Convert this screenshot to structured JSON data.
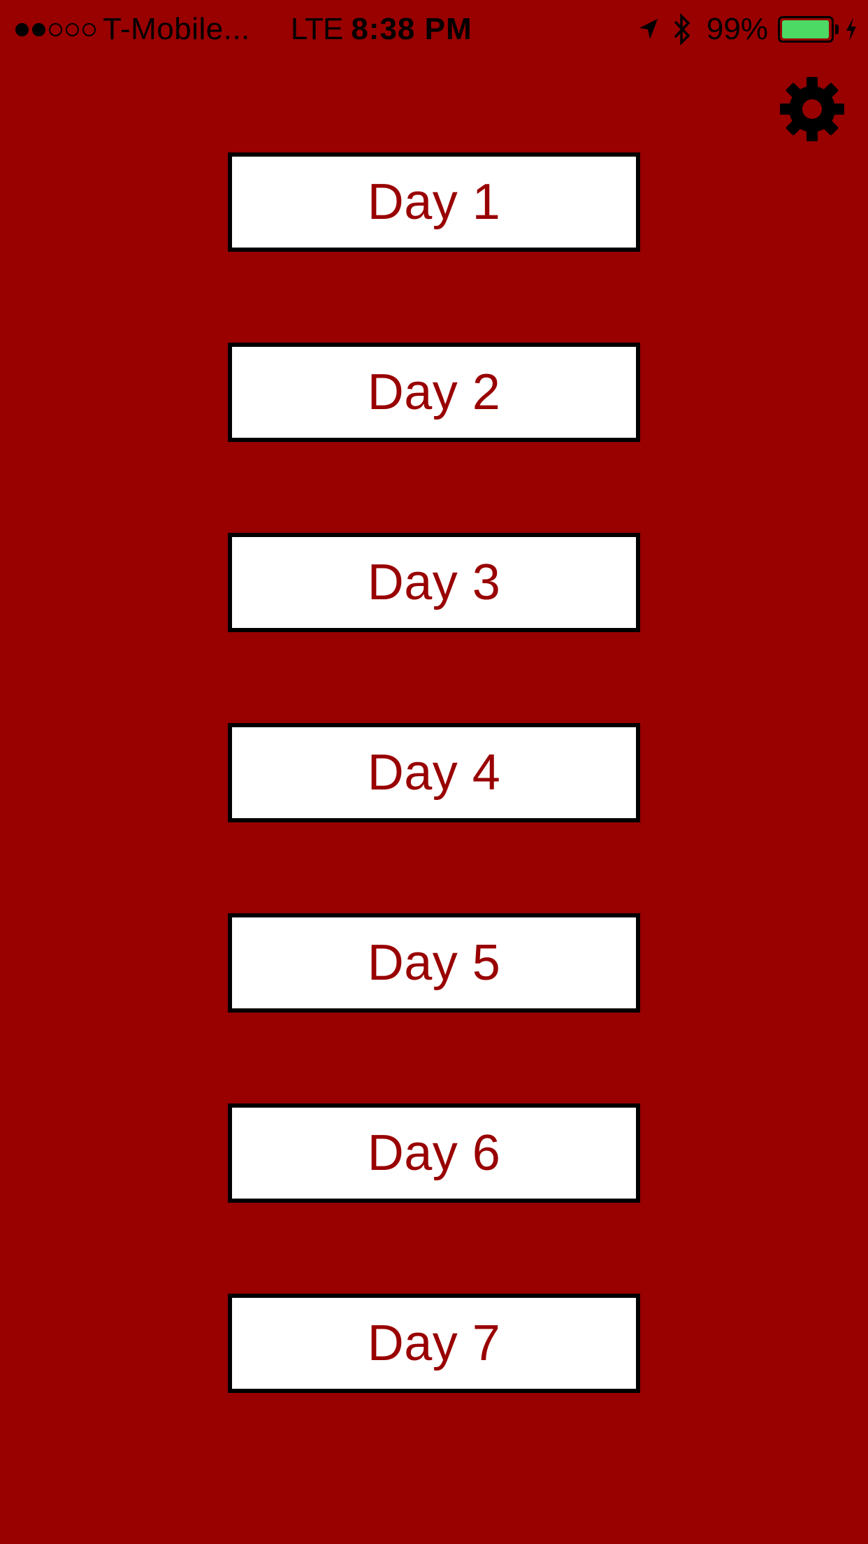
{
  "status_bar": {
    "carrier": "T-Mobile...",
    "network": "LTE",
    "time": "8:38 PM",
    "battery_percent_label": "99%",
    "battery_level": 0.99,
    "signal_bars_filled": 2,
    "signal_bars_total": 5
  },
  "header": {
    "settings_icon": "gear-icon"
  },
  "days": [
    {
      "label": "Day 1"
    },
    {
      "label": "Day 2"
    },
    {
      "label": "Day 3"
    },
    {
      "label": "Day 4"
    },
    {
      "label": "Day 5"
    },
    {
      "label": "Day 6"
    },
    {
      "label": "Day 7"
    }
  ],
  "colors": {
    "background": "#990000",
    "button_background": "#ffffff",
    "button_text": "#990000",
    "button_border": "#000000",
    "battery_fill": "#4cd964"
  }
}
